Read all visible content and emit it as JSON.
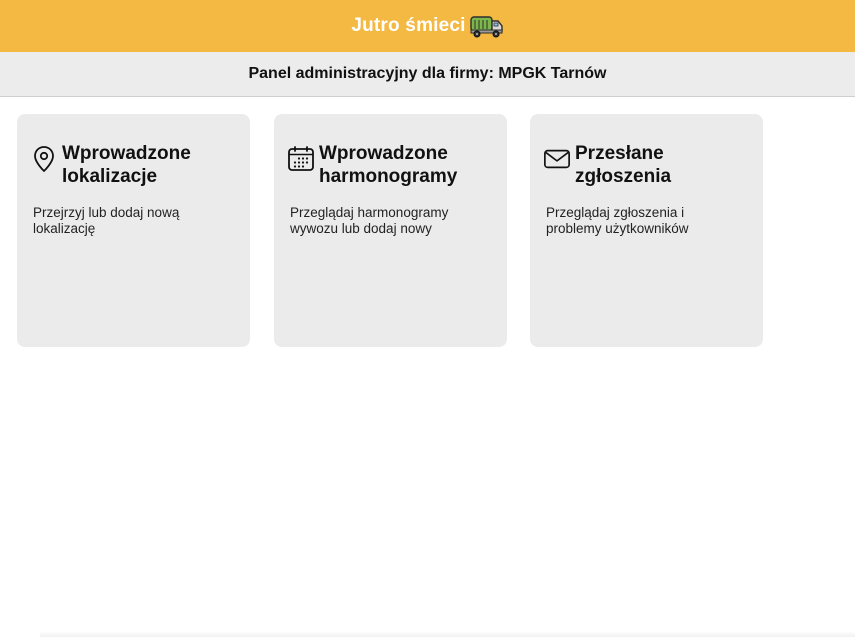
{
  "header": {
    "app_title": "Jutro śmieci",
    "brand_color": "#f4b942",
    "logo_icon": "garbage-truck-icon"
  },
  "subheader": {
    "text": "Panel administracyjny dla firmy: MPGK Tarnów"
  },
  "cards": [
    {
      "icon": "location-pin-icon",
      "title_line1": "Wprowadzone",
      "title_line2": "lokalizacje",
      "description": "Przejrzyj lub dodaj nową lokalizację"
    },
    {
      "icon": "calendar-icon",
      "title_line1": "Wprowadzone",
      "title_line2": "harmonogramy",
      "description": "Przeglądaj harmonogramy wywozu lub dodaj nowy"
    },
    {
      "icon": "envelope-icon",
      "title_line1": "Przesłane",
      "title_line2": "zgłoszenia",
      "description": "Przeglądaj zgłoszenia i problemy użytkowników"
    }
  ]
}
